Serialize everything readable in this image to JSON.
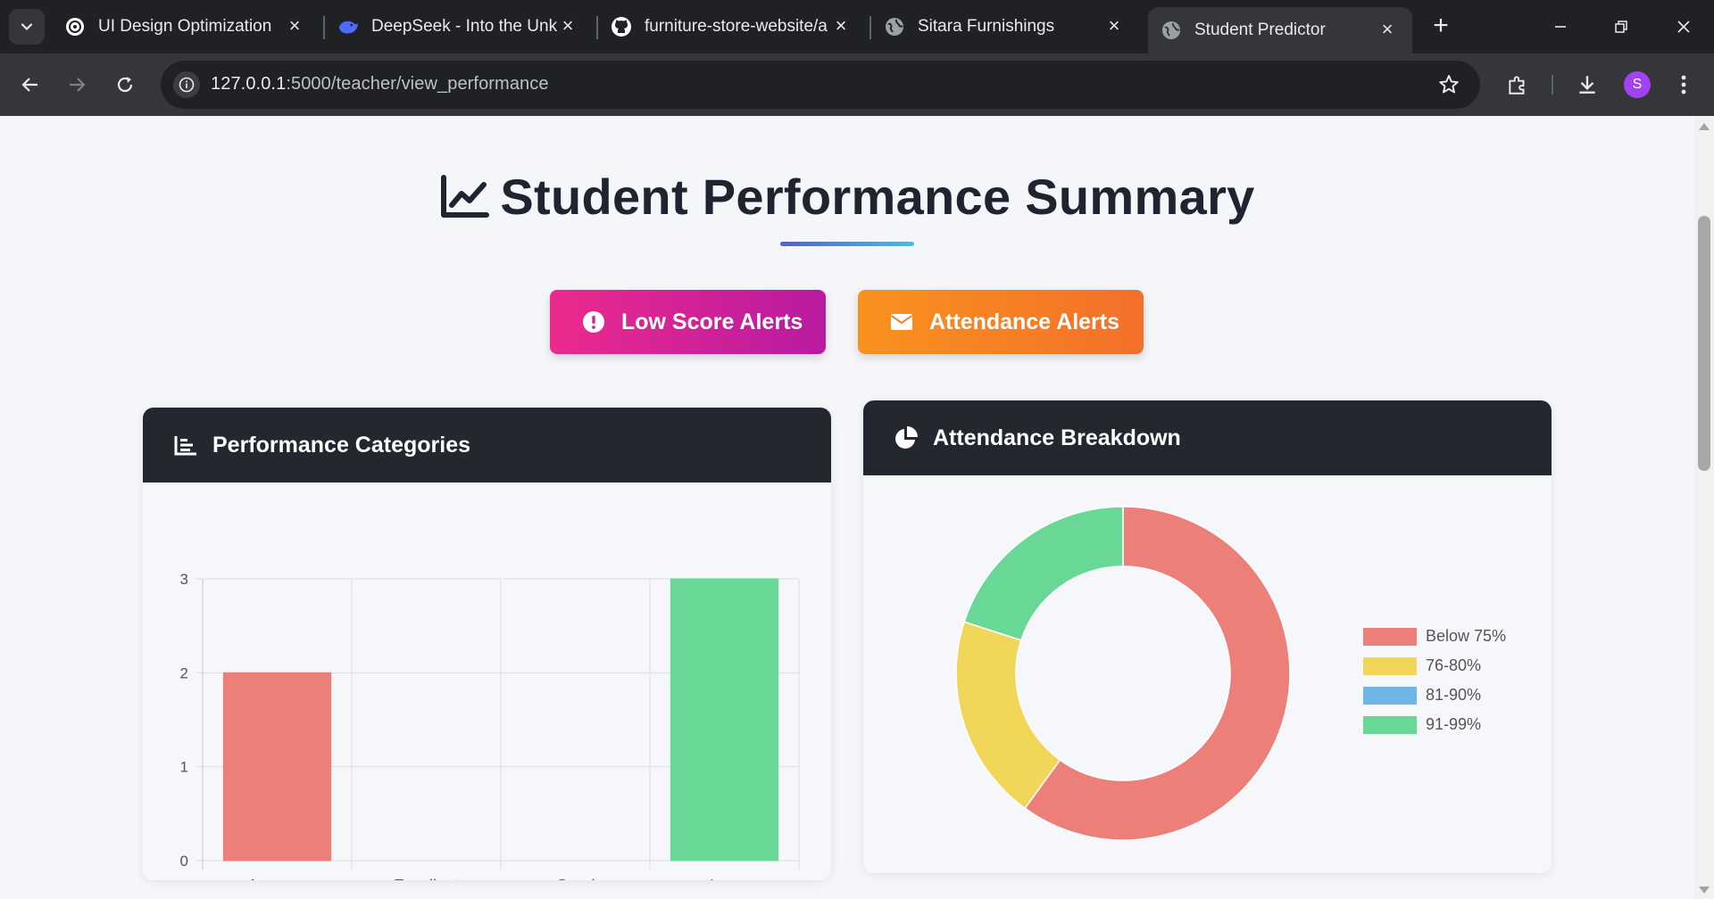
{
  "browser": {
    "tabs": [
      {
        "title": "UI Design Optimization",
        "icon": "openai-icon"
      },
      {
        "title": "DeepSeek - Into the Unk",
        "icon": "deepseek-icon"
      },
      {
        "title": "furniture-store-website/a",
        "icon": "github-icon"
      },
      {
        "title": "Sitara Furnishings",
        "icon": "globe-icon"
      },
      {
        "title": "Student Predictor",
        "icon": "globe-icon",
        "active": true
      }
    ],
    "url_host": "127.0.0.1",
    "url_path": ":5000/teacher/view_performance",
    "profile_initial": "S"
  },
  "page": {
    "title": "Student Performance Summary",
    "buttons": {
      "low_score": "Low Score Alerts",
      "attendance": "Attendance Alerts"
    },
    "cards": {
      "performance": "Performance Categories",
      "attendance": "Attendance Breakdown"
    }
  },
  "colors": {
    "accent_pink": "#ec2a8d",
    "accent_orange": "#f8921e",
    "card_header": "#23272f"
  },
  "chart_data": [
    {
      "type": "bar",
      "title": "Performance Categories",
      "categories": [
        "Average",
        "Excellent",
        "Good",
        "Low"
      ],
      "values": [
        2,
        0,
        0,
        3
      ],
      "colors": [
        "#ec7f78",
        "#f2d65a",
        "#6fb5e8",
        "#69d897"
      ],
      "ylim": [
        0,
        3
      ],
      "yticks": [
        0,
        1,
        2,
        3
      ],
      "grid": true
    },
    {
      "type": "pie",
      "style": "doughnut",
      "title": "Attendance Breakdown",
      "labels": [
        "Below 75%",
        "76-80%",
        "81-90%",
        "91-99%"
      ],
      "values": [
        3,
        1,
        0,
        1
      ],
      "colors": [
        "#ec7f78",
        "#f2d65a",
        "#6fb5e8",
        "#69d897"
      ],
      "legend": "right"
    }
  ]
}
